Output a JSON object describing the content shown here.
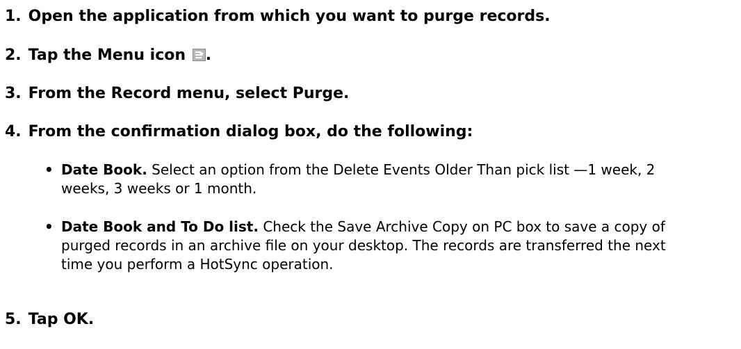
{
  "steps": [
    {
      "num": "1.",
      "text": "Open the application from which you want to purge records."
    },
    {
      "num": "2.",
      "text": "Tap the Menu icon",
      "icon": "menu-icon",
      "after_icon": "."
    },
    {
      "num": "3.",
      "text": "From the Record menu, select Purge."
    },
    {
      "num": "4.",
      "text": "From the confirmation dialog box, do the following:"
    },
    {
      "num": "5.",
      "text": "Tap OK."
    }
  ],
  "bullets": [
    {
      "marker": "•",
      "lead": "Date Book.",
      "text": " Select an option from the Delete Events Older Than pick list —1 week, 2 weeks, 3 weeks or 1 month."
    },
    {
      "marker": "•",
      "lead": "Date Book and To Do list.",
      "text": " Check the Save Archive Copy on PC box to save a copy of purged records in an archive file on your desktop. The records are transferred the next time you perform a HotSync operation."
    }
  ]
}
